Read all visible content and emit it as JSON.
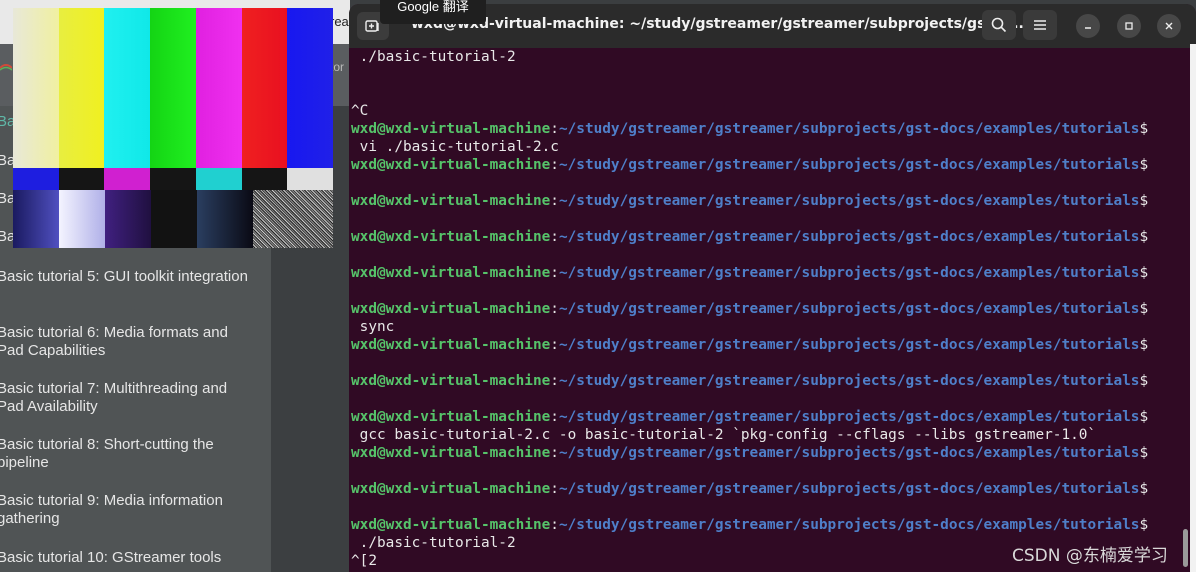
{
  "tooltip": "Google 翻译",
  "browser": {
    "tab_fragment": "rea",
    "address_fragment": "tor",
    "sidebar": {
      "active_fragment": "Ba",
      "fragments": [
        "Ba",
        "Ba",
        "Ba"
      ],
      "items": [
        {
          "label": "Basic tutorial 5: GUI toolkit integration"
        },
        {
          "label": "Basic tutorial 6: Media formats and Pad Capabilities"
        },
        {
          "label": "Basic tutorial 7: Multithreading and Pad Availability"
        },
        {
          "label": "Basic tutorial 8: Short-cutting the pipeline"
        },
        {
          "label": "Basic tutorial 9: Media information gathering"
        },
        {
          "label": "Basic tutorial 10: GStreamer tools"
        }
      ]
    }
  },
  "terminal": {
    "title": "wxd@wxd-virtual-machine: ~/study/gstreamer/gstreamer/subprojects/gst-d...",
    "icons": {
      "new_tab": "new-tab-icon",
      "search": "search-icon",
      "menu": "hamburger-menu-icon",
      "minimize": "minimize-icon",
      "maximize": "maximize-icon",
      "close": "close-icon"
    },
    "prompt": {
      "user": "wxd@wxd-virtual-machine",
      "path": "~/study/gstreamer/gstreamer/subprojects/gst-docs/examples/tutorials",
      "symbol": "$"
    },
    "lines": [
      {
        "kind": "text",
        "text": " ./basic-tutorial-2"
      },
      {
        "kind": "text",
        "text": ""
      },
      {
        "kind": "text",
        "text": ""
      },
      {
        "kind": "text",
        "text": "^C"
      },
      {
        "kind": "prompt"
      },
      {
        "kind": "text",
        "text": " vi ./basic-tutorial-2.c"
      },
      {
        "kind": "prompt"
      },
      {
        "kind": "text",
        "text": ""
      },
      {
        "kind": "prompt"
      },
      {
        "kind": "text",
        "text": ""
      },
      {
        "kind": "prompt"
      },
      {
        "kind": "text",
        "text": ""
      },
      {
        "kind": "prompt"
      },
      {
        "kind": "text",
        "text": ""
      },
      {
        "kind": "prompt"
      },
      {
        "kind": "text",
        "text": " sync"
      },
      {
        "kind": "prompt"
      },
      {
        "kind": "text",
        "text": ""
      },
      {
        "kind": "prompt"
      },
      {
        "kind": "text",
        "text": ""
      },
      {
        "kind": "prompt"
      },
      {
        "kind": "text",
        "text": " gcc basic-tutorial-2.c -o basic-tutorial-2 `pkg-config --cflags --libs gstreamer-1.0`"
      },
      {
        "kind": "prompt"
      },
      {
        "kind": "text",
        "text": ""
      },
      {
        "kind": "prompt"
      },
      {
        "kind": "text",
        "text": ""
      },
      {
        "kind": "prompt"
      },
      {
        "kind": "text",
        "text": " ./basic-tutorial-2"
      },
      {
        "kind": "text",
        "text": "^[2"
      }
    ]
  },
  "watermark": "CSDN @东楠爱学习",
  "colors": {
    "terminal_bg": "#300a24",
    "prompt_user": "#56c46a",
    "prompt_path": "#4f7fc9",
    "sidebar_active": "#5fb8a8"
  }
}
